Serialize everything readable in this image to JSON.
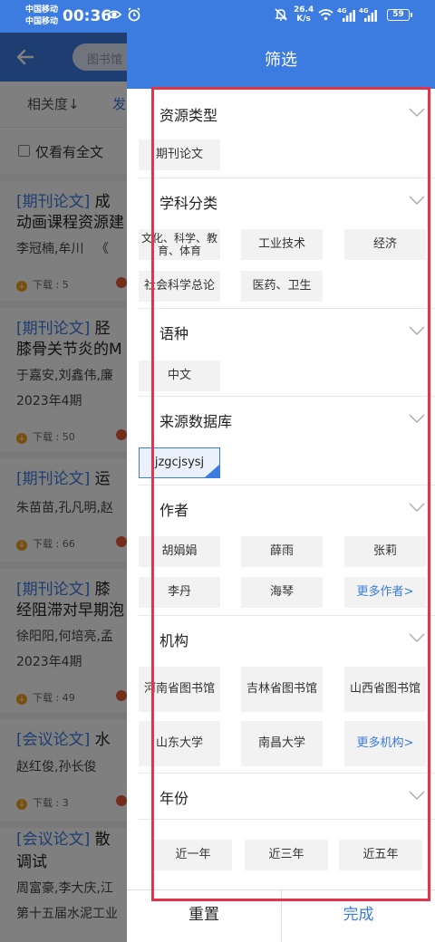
{
  "status_bar": {
    "carrier1": "中国移动",
    "carrier2": "中国移动",
    "time": "00:36",
    "net_speed": "26.4",
    "net_unit": "K/s",
    "signal1_label": "4G",
    "signal2_label": "4G",
    "battery": "59"
  },
  "background": {
    "search_placeholder": "图书馆",
    "sort_relevance": "相关度↓",
    "sort_second": "发",
    "fulltext_label": "仅看有全文",
    "items": [
      {
        "tag": "[期刊论文]",
        "title1": "成",
        "title2": "动画课程资源建",
        "meta1": "李冠楠,牟川",
        "meta1b": "《",
        "meta2": "",
        "downloads": "下载 : 5"
      },
      {
        "tag": "[期刊论文]",
        "title1": "胫",
        "title2": "膝骨关节炎的M",
        "meta1": "于嘉安,刘鑫伟,廉",
        "meta1b": "",
        "meta2": "2023年4期",
        "downloads": "下载 : 50"
      },
      {
        "tag": "[期刊论文]",
        "title1": "运",
        "title2": "",
        "meta1": "朱苗苗,孔凡明,赵",
        "meta1b": "",
        "meta2": "",
        "downloads": "下载 : 66"
      },
      {
        "tag": "[期刊论文]",
        "title1": "膝",
        "title2": "经阻滞对早期泡",
        "meta1": "徐阳阳,何培亮,孟",
        "meta1b": "",
        "meta2": "2023年4期",
        "downloads": "下载 : 49"
      },
      {
        "tag": "[会议论文]",
        "title1": "水",
        "title2": "",
        "meta1": "赵红俊,孙长俊",
        "meta1b": "",
        "meta2": "",
        "downloads": "下载 : 3"
      },
      {
        "tag": "[会议论文]",
        "title1": "散",
        "title2": "调试",
        "meta1": "周富豪,李大庆,江",
        "meta1b": "",
        "meta2": "第十五届水泥工业",
        "downloads": ""
      }
    ]
  },
  "drawer": {
    "title": "筛选",
    "sections": [
      {
        "title": "资源类型",
        "options": [
          "期刊论文"
        ]
      },
      {
        "title": "学科分类",
        "options": [
          "文化、科学、教育、体育",
          "工业技术",
          "经济",
          "社会科学总论",
          "医药、卫生"
        ]
      },
      {
        "title": "语种",
        "options": [
          "中文"
        ]
      },
      {
        "title": "来源数据库",
        "options": [
          "jzgcjsysj"
        ]
      },
      {
        "title": "作者",
        "options": [
          "胡娟娟",
          "薛雨",
          "张莉",
          "李丹",
          "海琴",
          "更多作者>"
        ]
      },
      {
        "title": "机构",
        "options": [
          "河南省图书馆",
          "吉林省图书馆",
          "山西省图书馆",
          "山东大学",
          "南昌大学",
          "更多机构>"
        ]
      },
      {
        "title": "年份",
        "options": [
          "近一年",
          "近三年",
          "近五年"
        ]
      }
    ],
    "reset_label": "重置",
    "done_label": "完成"
  },
  "colors": {
    "accent": "#3c7be0",
    "highlight_box": "#e6334a"
  }
}
